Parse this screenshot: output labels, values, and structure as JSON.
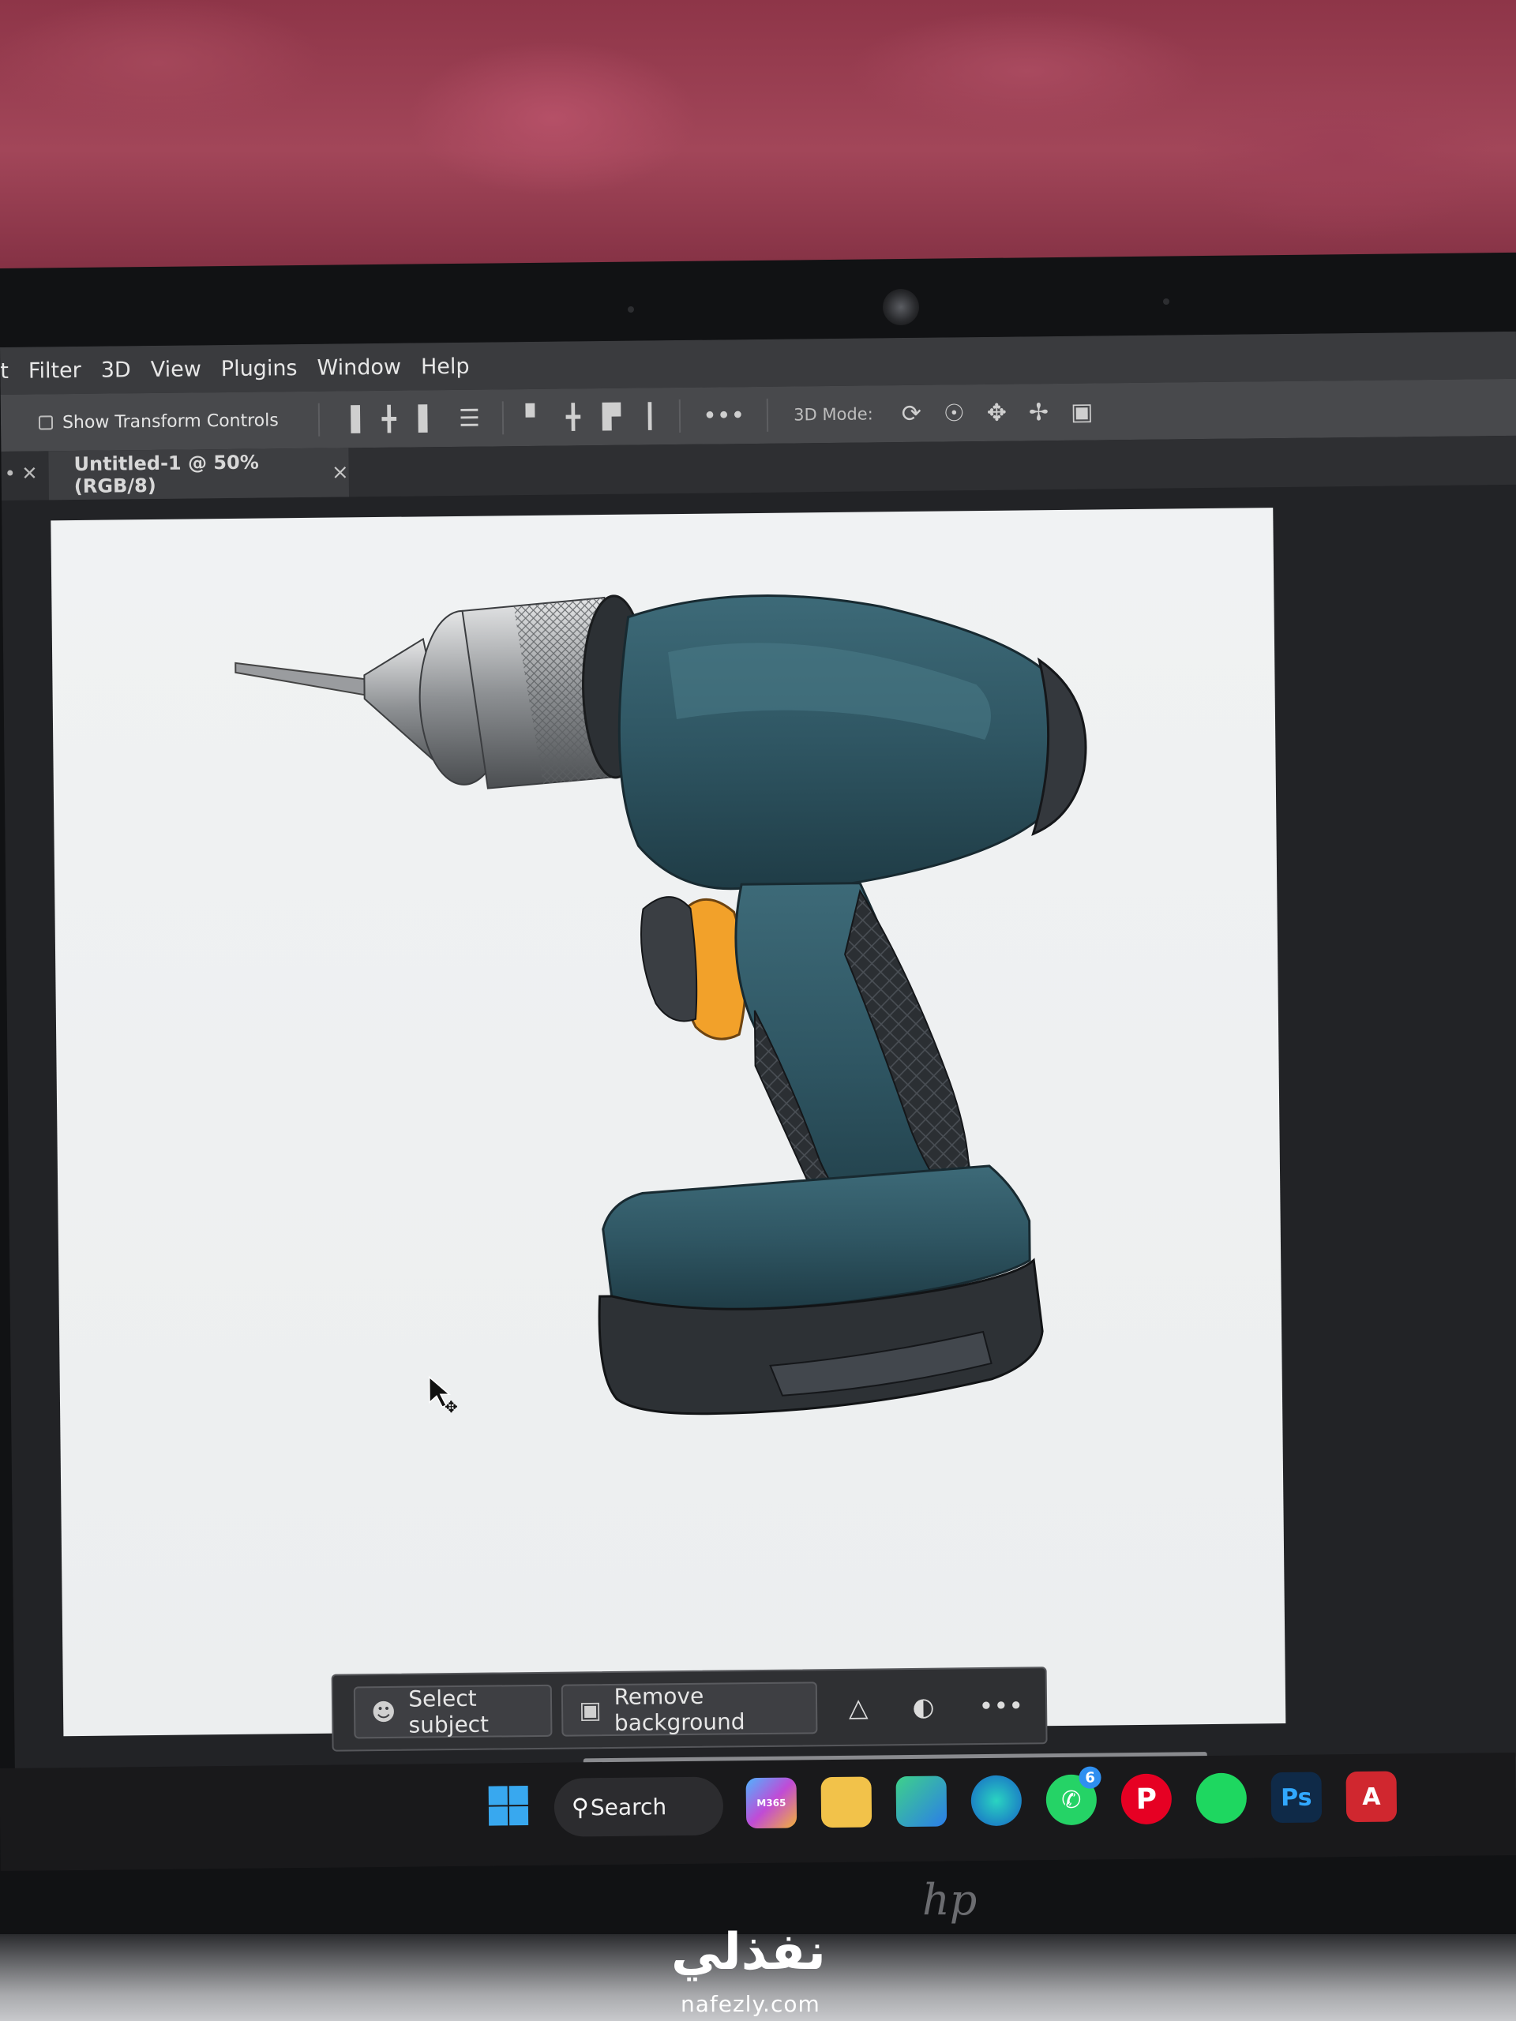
{
  "menu": [
    "t",
    "Filter",
    "3D",
    "View",
    "Plugins",
    "Window",
    "Help"
  ],
  "options": {
    "show_transform_controls": "Show Transform Controls",
    "more": "•••",
    "mode_3d": "3D Mode:"
  },
  "document_tab": {
    "title": "Untitled-1 @ 50% (RGB/8)",
    "close": "×"
  },
  "contextual_taskbar": {
    "select_subject": "Select subject",
    "remove_background": "Remove background",
    "more": "•••"
  },
  "taskbar": {
    "search": "Search",
    "whatsapp_badge": "6",
    "ps_label": "Ps",
    "cad_label": "A",
    "m365_label": "M365"
  },
  "watermark": {
    "arabic": "نفذلي",
    "url": "nafezly.com"
  },
  "colors": {
    "drill_body": "#2f5663",
    "trigger": "#f2a12a",
    "canvas": "#eef0f1"
  }
}
